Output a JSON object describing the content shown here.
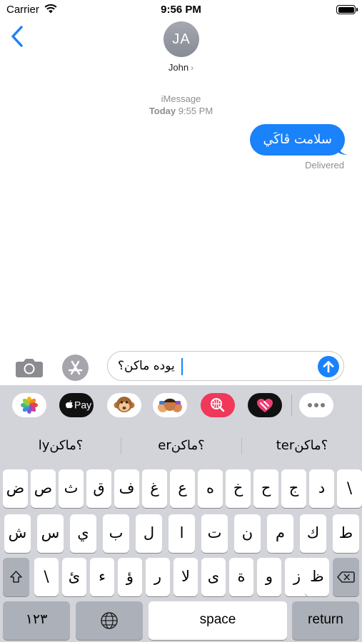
{
  "status": {
    "carrier": "Carrier",
    "time": "9:56 PM",
    "battery_level": 1.0
  },
  "header": {
    "avatar_initials": "JA",
    "contact_name": "John"
  },
  "conversation": {
    "service": "iMessage",
    "timestamp_day": "Today",
    "timestamp_time": "9:55 PM",
    "messages": [
      {
        "text": "سلامت ڨاكَي",
        "from": "me",
        "status": "Delivered"
      }
    ]
  },
  "input": {
    "text": "يوده ماكن؟"
  },
  "apps": [
    "photos-app",
    "apple-pay-app",
    "monkey-memoji-app",
    "memoji-stickers-app",
    "image-search-app",
    "digital-touch-app",
    "more-apps"
  ],
  "apple_pay_label": "Pay",
  "suggestions": [
    "ly؟ماكن",
    "er؟ماكن",
    "ter؟ماكن"
  ],
  "keyboard": {
    "row1": [
      "ض",
      "ص",
      "ث",
      "ق",
      "ف",
      "غ",
      "ع",
      "ه",
      "خ",
      "ح",
      "ج",
      "د",
      "\\"
    ],
    "row2": [
      "ش",
      "س",
      "ي",
      "ب",
      "ل",
      "ا",
      "ت",
      "ن",
      "م",
      "ك",
      "ط"
    ],
    "row3": [
      "\\",
      "ئ",
      "ء",
      "ؤ",
      "ر",
      "لا",
      "ى",
      "ة",
      "و",
      "ز",
      "ظ"
    ],
    "numbers_label": "١٢٣",
    "space_label": "space",
    "return_label": "return"
  },
  "colors": {
    "accent": "#1a82fb",
    "keyboard_bg": "#d2d4da"
  }
}
